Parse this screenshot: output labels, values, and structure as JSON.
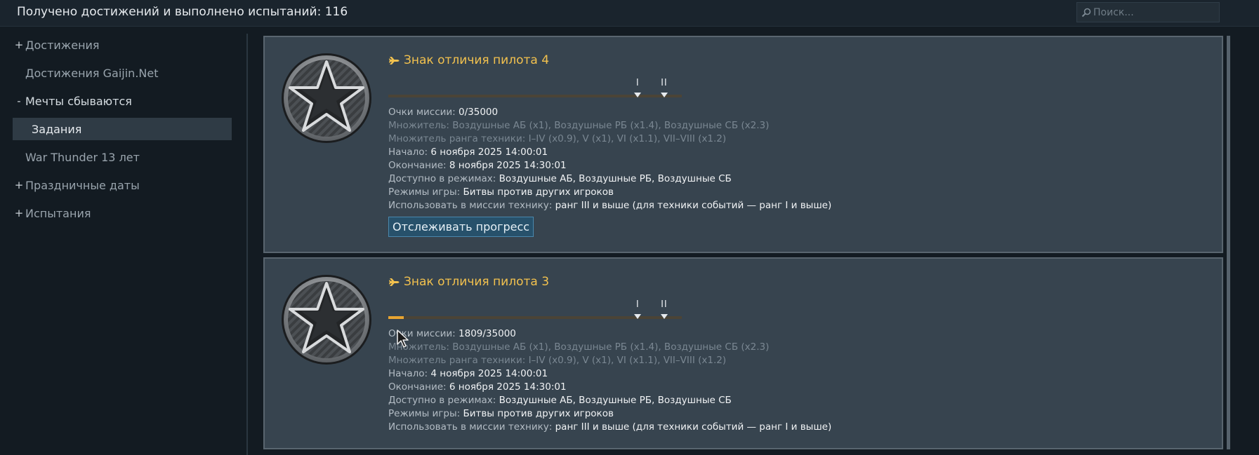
{
  "header": {
    "title": "Получено достижений и выполнено испытаний: 116",
    "search_placeholder": "Поиск...",
    "search_value": ""
  },
  "sidebar": {
    "items": [
      {
        "expander": "+",
        "label": "Достижения",
        "state": "collapsed"
      },
      {
        "expander": "",
        "label": "Достижения Gaijin.Net",
        "state": "leaf"
      },
      {
        "expander": "-",
        "label": "Мечты сбываются",
        "state": "expanded"
      },
      {
        "expander": "",
        "label": "Задания",
        "state": "selected"
      },
      {
        "expander": "",
        "label": "War Thunder 13 лет",
        "state": "leaf"
      },
      {
        "expander": "+",
        "label": "Праздничные даты",
        "state": "collapsed"
      },
      {
        "expander": "+",
        "label": "Испытания",
        "state": "collapsed"
      }
    ]
  },
  "colors": {
    "accent_title": "#f2c14e",
    "progress_fill": "#e8a531",
    "card_bg": "#37444f",
    "button_bg": "#27516b"
  },
  "missions": [
    {
      "title": "Знак отличия пилота 4",
      "icon": "aircraft-icon",
      "medal": "star-medal-icon",
      "progress": {
        "current": 0,
        "total": 35000,
        "markers": [
          {
            "label": "I",
            "value": 29750
          },
          {
            "label": "II",
            "value": 32900
          }
        ]
      },
      "rows": [
        {
          "k": "Очки миссии: ",
          "v": "0/35000",
          "dim": false
        },
        {
          "k": "Множитель: ",
          "v": "Воздушные АБ (x1), Воздушные РБ (x1.4), Воздушные СБ (x2.3)",
          "dim": true
        },
        {
          "k": "Множитель ранга техники: ",
          "v": "I–IV (x0.9), V (x1), VI (x1.1), VII–VIII (x1.2)",
          "dim": true
        },
        {
          "k": "Начало: ",
          "v": "6 ноября 2025 14:00:01",
          "dim": false
        },
        {
          "k": "Окончание: ",
          "v": "8 ноября 2025 14:30:01",
          "dim": false
        },
        {
          "k": "Доступно в режимах: ",
          "v": "Воздушные АБ, Воздушные РБ, Воздушные СБ",
          "dim": false
        },
        {
          "k": "Режимы игры: ",
          "v": "Битвы против других игроков",
          "dim": false
        },
        {
          "k": "Использовать в миссии технику: ",
          "v": "ранг III и выше (для техники событий — ранг I и выше)",
          "dim": false
        }
      ],
      "button": "Отслеживать прогресс"
    },
    {
      "title": "Знак отличия пилота 3",
      "icon": "aircraft-icon",
      "medal": "star-medal-icon",
      "progress": {
        "current": 1809,
        "total": 35000,
        "markers": [
          {
            "label": "I",
            "value": 29750
          },
          {
            "label": "II",
            "value": 32900
          }
        ]
      },
      "rows": [
        {
          "k": "Очки миссии: ",
          "v": "1809/35000",
          "dim": false
        },
        {
          "k": "Множитель: ",
          "v": "Воздушные АБ (x1), Воздушные РБ (x1.4), Воздушные СБ (x2.3)",
          "dim": true
        },
        {
          "k": "Множитель ранга техники: ",
          "v": "I–IV (x0.9), V (x1), VI (x1.1), VII–VIII (x1.2)",
          "dim": true
        },
        {
          "k": "Начало: ",
          "v": "4 ноября 2025 14:00:01",
          "dim": false
        },
        {
          "k": "Окончание: ",
          "v": "6 ноября 2025 14:30:01",
          "dim": false
        },
        {
          "k": "Доступно в режимах: ",
          "v": "Воздушные АБ, Воздушные РБ, Воздушные СБ",
          "dim": false
        },
        {
          "k": "Режимы игры: ",
          "v": "Битвы против других игроков",
          "dim": false
        },
        {
          "k": "Использовать в миссии технику: ",
          "v": "ранг III и выше (для техники событий — ранг I и выше)",
          "dim": false
        }
      ],
      "button": ""
    }
  ]
}
